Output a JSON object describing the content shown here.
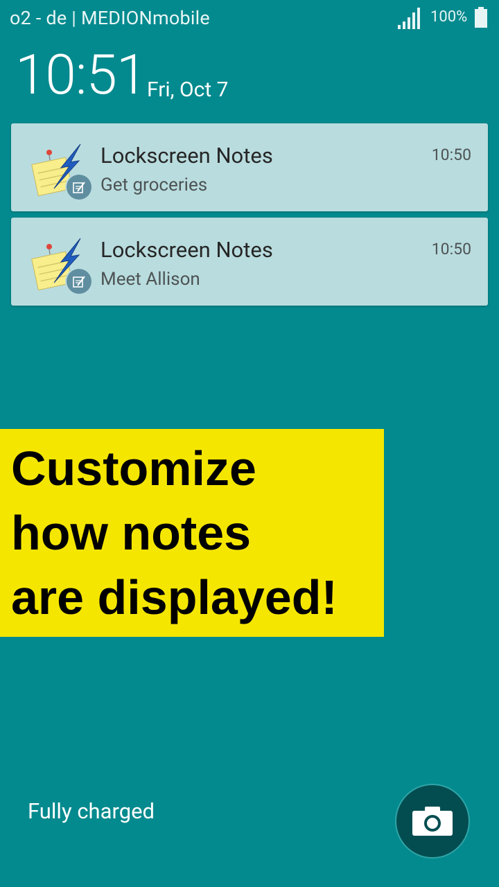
{
  "status_bar": {
    "carrier": "o2 - de | MEDIONmobile",
    "battery_percent": "100%",
    "battery_level": 1.0,
    "signal_bars": 5
  },
  "lockscreen": {
    "time": "10:51",
    "date": "Fri, Oct 7"
  },
  "notifications": [
    {
      "title": "Lockscreen Notes",
      "text": "Get groceries",
      "time": "10:50",
      "icon": "sticky-note-icon"
    },
    {
      "title": "Lockscreen Notes",
      "text": "Meet Allison",
      "time": "10:50",
      "icon": "sticky-note-icon"
    }
  ],
  "promo": {
    "line1": "Customize",
    "line2": "how notes",
    "line3": "are displayed!"
  },
  "footer": {
    "charge_status": "Fully charged",
    "camera_icon": "camera-icon"
  },
  "colors": {
    "background": "#038a8e",
    "notification_bg": "#b9dcde",
    "promo_bg": "#f5e600",
    "camera_button_bg": "#034d51"
  }
}
